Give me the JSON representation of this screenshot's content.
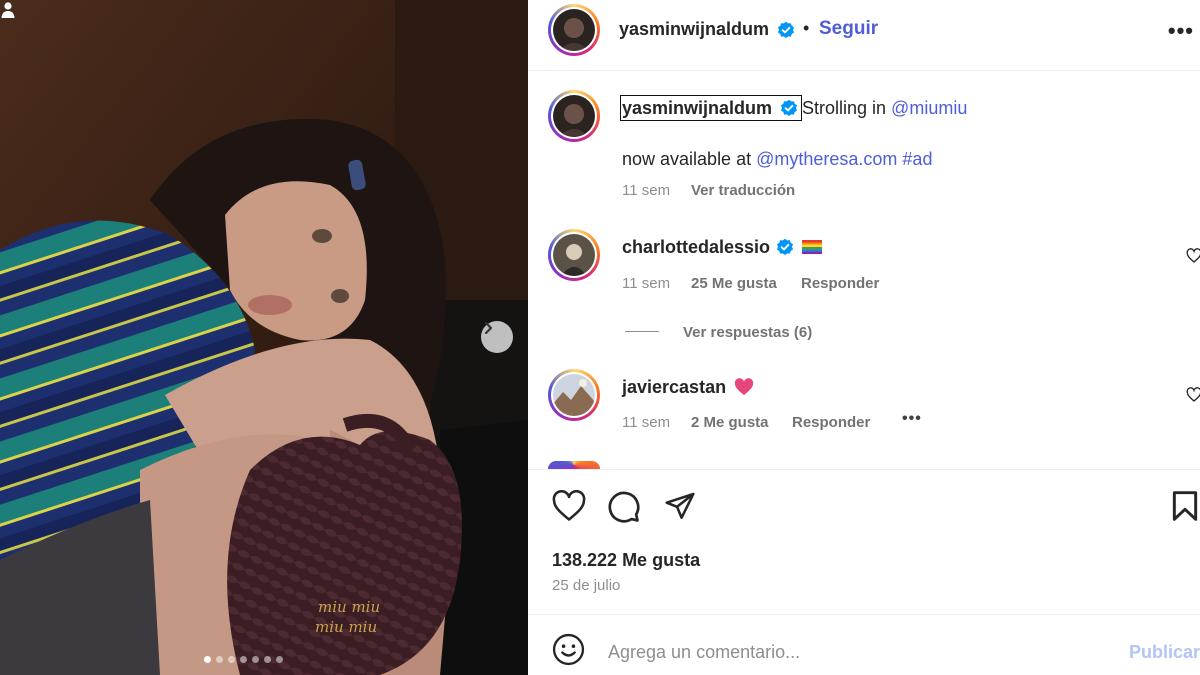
{
  "post": {
    "author": "yasminwijnaldum",
    "follow_label": "Seguir",
    "separator": "•",
    "more_label": "•••",
    "image_dots_total": 7,
    "image_dot_active": 1
  },
  "caption": {
    "author": "yasminwijnaldum",
    "line1_text": "Strolling in ",
    "line1_mention": "@miumiu",
    "line2_text": "now available at ",
    "line2_mention": "@mytheresa.com",
    "line2_hashtag": "#ad",
    "time": "11 sem",
    "translate_label": "Ver traducción"
  },
  "comments": [
    {
      "author": "charlottedalessio",
      "emoji_icon": "rainbow-flag-icon",
      "time": "11 sem",
      "likes": "25 Me gusta",
      "reply_label": "Responder",
      "view_replies": "Ver respuestas (6)"
    },
    {
      "author": "javiercastan",
      "emoji_icon": "pink-heart-icon",
      "time": "11 sem",
      "likes": "2 Me gusta",
      "reply_label": "Responder",
      "more_label": "•••"
    }
  ],
  "footer": {
    "likes": "138.222 Me gusta",
    "date": "25 de julio",
    "comment_placeholder": "Agrega un comentario...",
    "publish_label": "Publicar"
  },
  "colors": {
    "link": "#4e5dd8",
    "verified": "#0095f6",
    "muted": "#8e8e8e",
    "publish_disabled": "#b3c4f5"
  }
}
